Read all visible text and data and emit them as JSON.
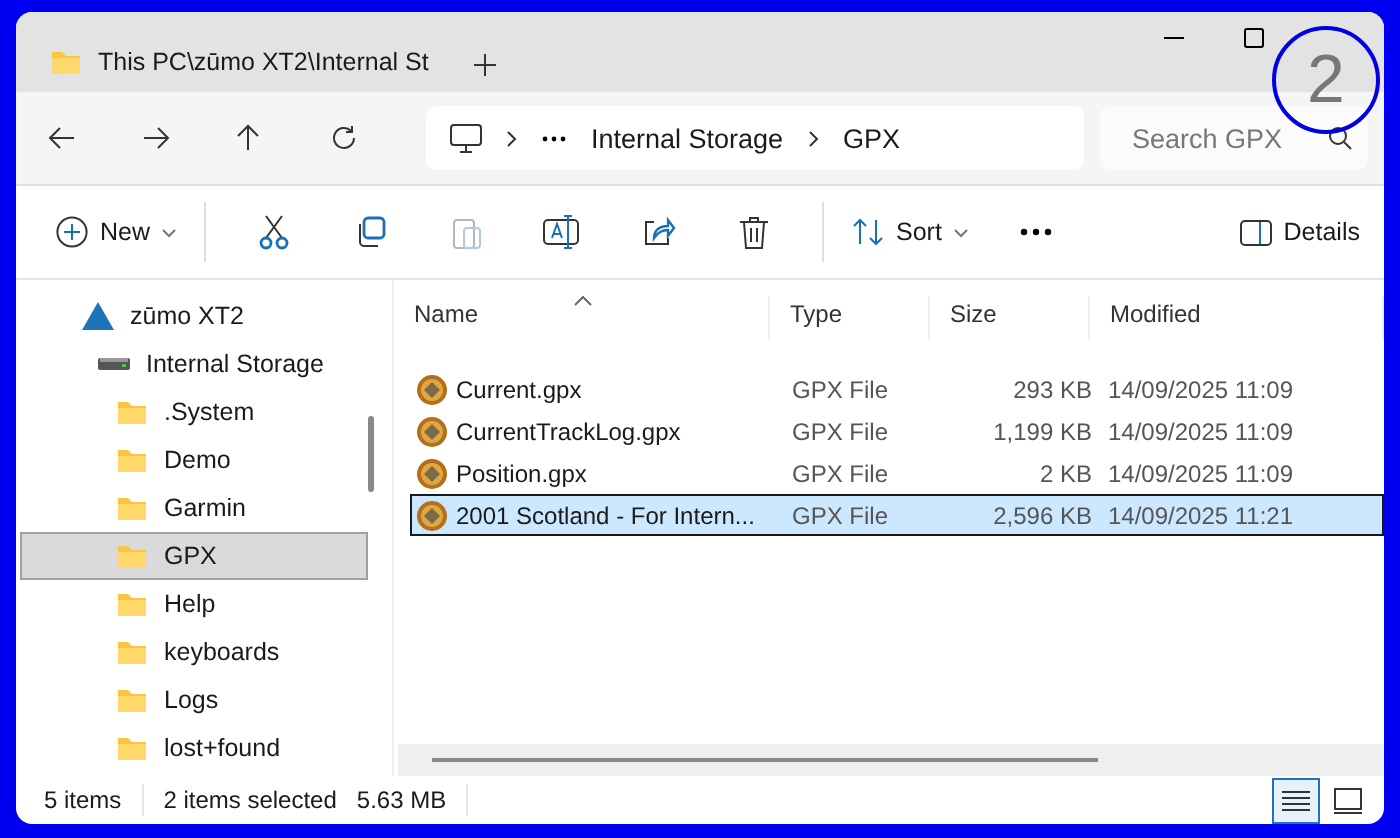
{
  "window": {
    "tab_title": "This PC\\zūmo XT2\\Internal St"
  },
  "address": {
    "breadcrumbs": [
      "Internal Storage",
      "GPX"
    ],
    "search": {
      "placeholder": "Search GPX"
    }
  },
  "toolbar": {
    "new_label": "New",
    "actions": [
      {
        "kind": "cut",
        "disabled": false
      },
      {
        "kind": "copy",
        "disabled": false
      },
      {
        "kind": "paste",
        "disabled": true
      },
      {
        "kind": "rename",
        "disabled": false
      },
      {
        "kind": "share",
        "disabled": false
      },
      {
        "kind": "delete",
        "disabled": false
      }
    ],
    "sort_label": "Sort",
    "details_label": "Details"
  },
  "sidebar": {
    "items": [
      {
        "label": "zūmo XT2",
        "kind": "device",
        "selected": false,
        "children": [
          {
            "label": "Internal Storage",
            "kind": "drive",
            "selected": false,
            "children": [
              {
                "label": ".System",
                "kind": "folder",
                "selected": false
              },
              {
                "label": "Demo",
                "kind": "folder",
                "selected": false
              },
              {
                "label": "Garmin",
                "kind": "folder",
                "selected": false
              },
              {
                "label": "GPX",
                "kind": "folder",
                "selected": true
              },
              {
                "label": "Help",
                "kind": "folder",
                "selected": false
              },
              {
                "label": "keyboards",
                "kind": "folder",
                "selected": false
              },
              {
                "label": "Logs",
                "kind": "folder",
                "selected": false
              },
              {
                "label": "lost+found",
                "kind": "folder",
                "selected": false
              }
            ]
          }
        ]
      }
    ]
  },
  "table": {
    "columns": [
      {
        "label": "Name",
        "sorted": true
      },
      {
        "label": "Type",
        "sorted": false
      },
      {
        "label": "Size",
        "sorted": false
      },
      {
        "label": "Modified",
        "sorted": false
      }
    ],
    "rows": [
      {
        "name": "Current.gpx",
        "type": "GPX File",
        "size": "293 KB",
        "modified": "14/09/2025 11:09",
        "selected": false
      },
      {
        "name": "CurrentTrackLog.gpx",
        "type": "GPX File",
        "size": "1,199 KB",
        "modified": "14/09/2025 11:09",
        "selected": false
      },
      {
        "name": "Position.gpx",
        "type": "GPX File",
        "size": "2 KB",
        "modified": "14/09/2025 11:09",
        "selected": false
      },
      {
        "name": "2001 Scotland - For Intern...",
        "type": "GPX File",
        "size": "2,596 KB",
        "modified": "14/09/2025 11:21",
        "selected": true
      }
    ]
  },
  "status_bar": {
    "item_count": "5 items",
    "selection": "2 items selected",
    "selection_size": "5.63 MB",
    "views": [
      {
        "kind": "details",
        "selected": true
      },
      {
        "kind": "tiles",
        "selected": false
      }
    ]
  },
  "annotation": {
    "label": "2"
  }
}
